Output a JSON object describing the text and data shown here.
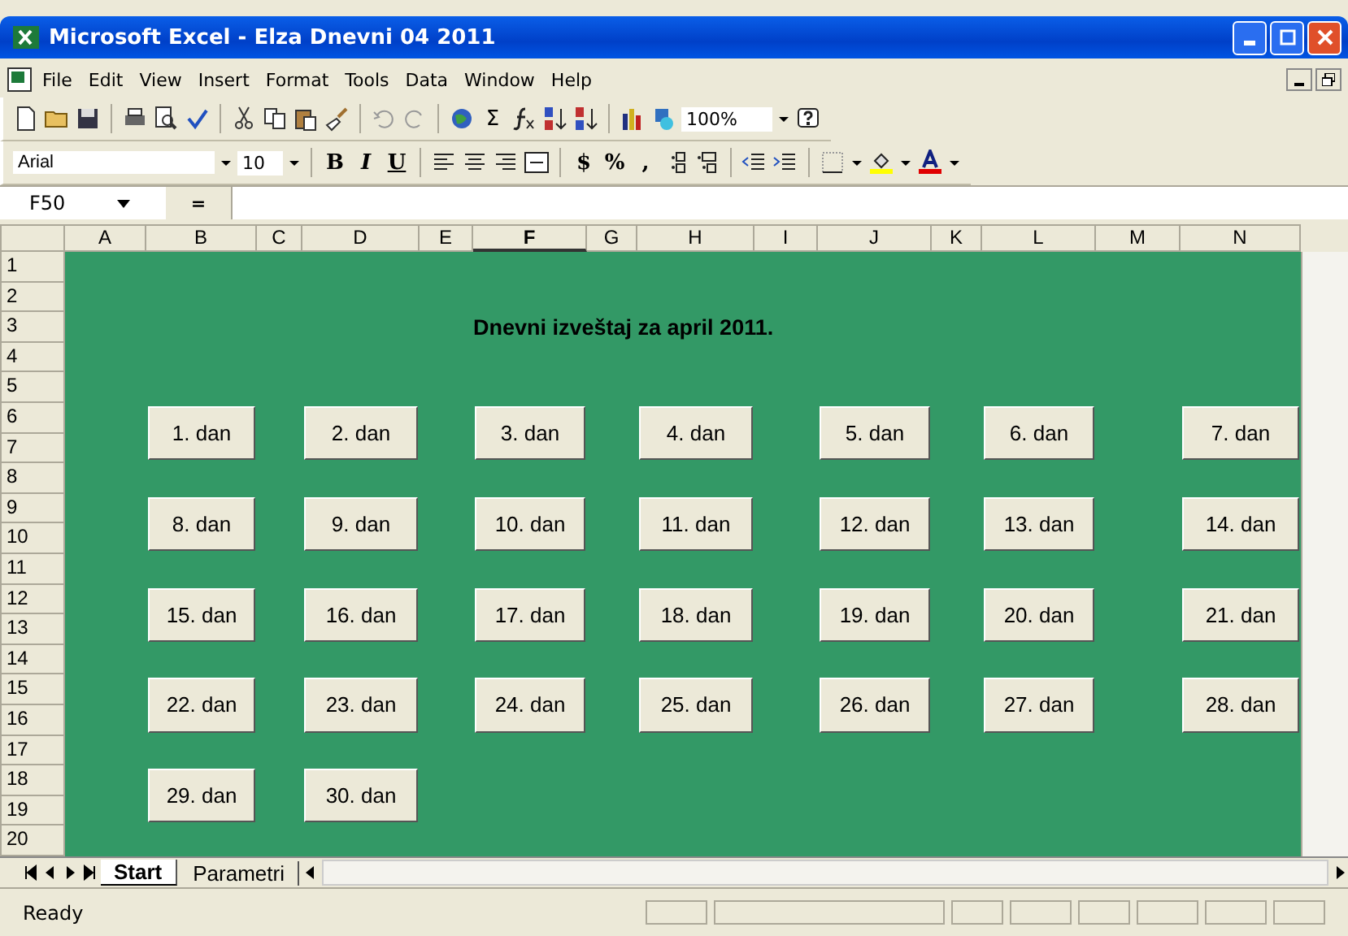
{
  "window": {
    "title": "Microsoft Excel - Elza Dnevni 04 2011"
  },
  "menu": [
    "File",
    "Edit",
    "View",
    "Insert",
    "Format",
    "Tools",
    "Data",
    "Window",
    "Help"
  ],
  "standard_toolbar": {
    "sigma": "Σ",
    "zoom": "100%"
  },
  "formatting_toolbar": {
    "font": "Arial",
    "size": "10",
    "bold": "B",
    "italic": "I",
    "underline": "U",
    "currency": "$",
    "percent": "%",
    "comma": ","
  },
  "formula_bar": {
    "name_box": "F50",
    "equals": "="
  },
  "columns": [
    "A",
    "B",
    "C",
    "D",
    "E",
    "F",
    "G",
    "H",
    "I",
    "J",
    "K",
    "L",
    "M",
    "N"
  ],
  "rows": [
    "1",
    "2",
    "3",
    "4",
    "5",
    "6",
    "7",
    "8",
    "9",
    "10",
    "11",
    "12",
    "13",
    "14",
    "15",
    "16",
    "17",
    "18",
    "19",
    "20"
  ],
  "sheet": {
    "heading": "Dnevni izveštaj za april 2011.",
    "day_buttons": [
      "1. dan",
      "2. dan",
      "3. dan",
      "4. dan",
      "5. dan",
      "6. dan",
      "7. dan",
      "8. dan",
      "9. dan",
      "10. dan",
      "11. dan",
      "12. dan",
      "13. dan",
      "14. dan",
      "15. dan",
      "16. dan",
      "17. dan",
      "18. dan",
      "19. dan",
      "20. dan",
      "21. dan",
      "22. dan",
      "23. dan",
      "24. dan",
      "25. dan",
      "26. dan",
      "27. dan",
      "28. dan",
      "29. dan",
      "30. dan"
    ]
  },
  "sheet_tabs": [
    {
      "label": "Start",
      "selected": true
    },
    {
      "label": "Parametri",
      "selected": false
    }
  ],
  "status_bar": {
    "text": "Ready"
  }
}
